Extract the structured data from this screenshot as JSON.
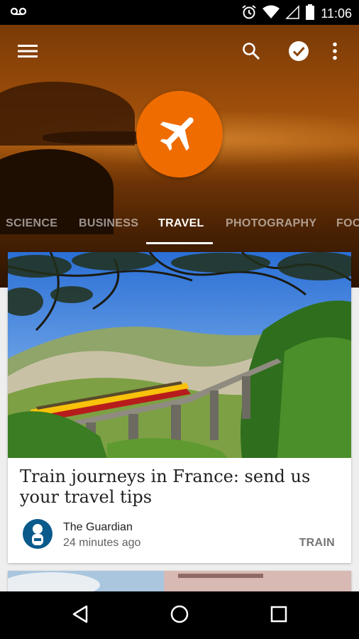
{
  "status_bar": {
    "time": "11:06",
    "icons": [
      "voicemail-icon",
      "alarm-icon",
      "wifi-icon",
      "signal-icon",
      "battery-icon"
    ]
  },
  "toolbar": {
    "icons": [
      "menu-icon",
      "search-icon",
      "check-circle-icon",
      "more-vert-icon"
    ]
  },
  "topic": {
    "icon": "airplane-icon",
    "icon_color": "#ef6c00"
  },
  "tabs": [
    {
      "label": "SCIENCE",
      "active": false
    },
    {
      "label": "BUSINESS",
      "active": false
    },
    {
      "label": "TRAVEL",
      "active": true
    },
    {
      "label": "PHOTOGRAPHY",
      "active": false
    },
    {
      "label": "FOO",
      "active": false
    }
  ],
  "cards": [
    {
      "title": "Train journeys in France: send us your travel tips",
      "source": "The Guardian",
      "time": "24 minutes ago",
      "tag": "TRAIN"
    }
  ],
  "navigation": {
    "icons": [
      "back-icon",
      "home-icon",
      "recents-icon"
    ]
  }
}
